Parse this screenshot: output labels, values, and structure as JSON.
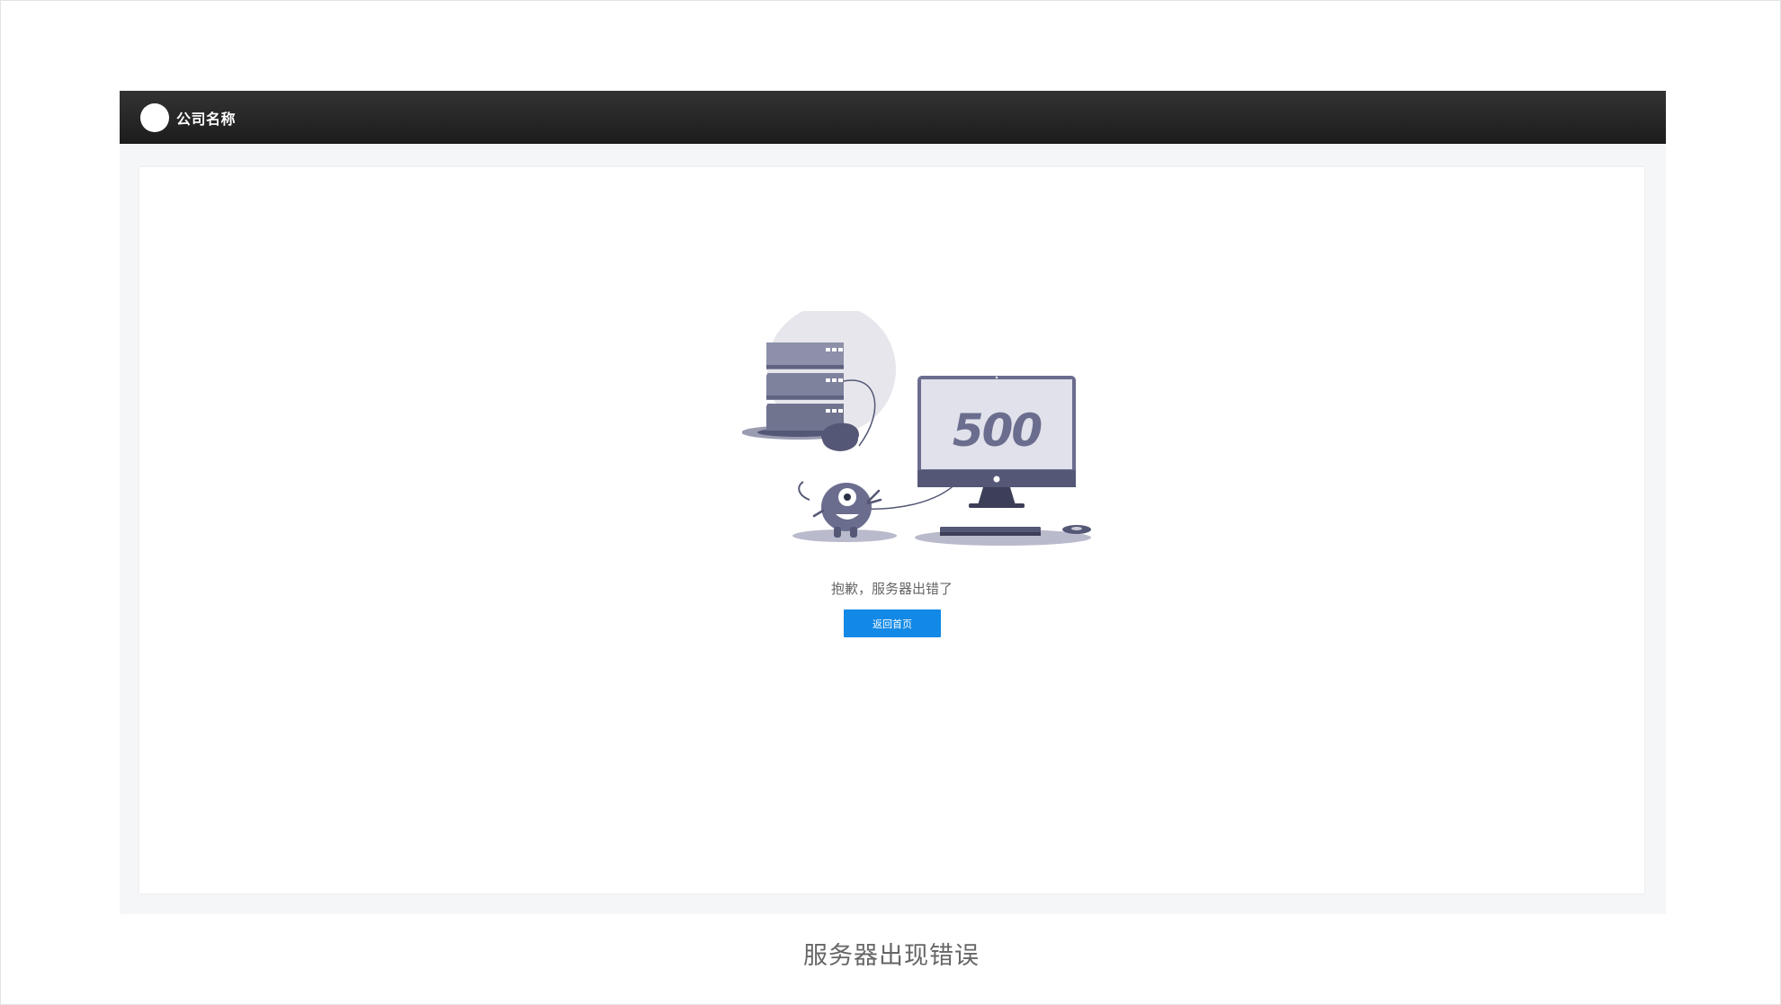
{
  "header": {
    "company_name": "公司名称"
  },
  "illustration": {
    "error_code": "500",
    "icons": [
      "server-icon",
      "monster-icon",
      "monitor-icon",
      "mouse-icon"
    ]
  },
  "main": {
    "message": "抱歉，服务器出错了",
    "home_button_label": "返回首页"
  },
  "caption": "服务器出现错误",
  "colors": {
    "topbar": "#1f1f1f",
    "page_bg": "#f5f6f8",
    "button": "#1289e6",
    "illustration_primary": "#6a6d8e",
    "illustration_light": "#e6e6ec"
  }
}
